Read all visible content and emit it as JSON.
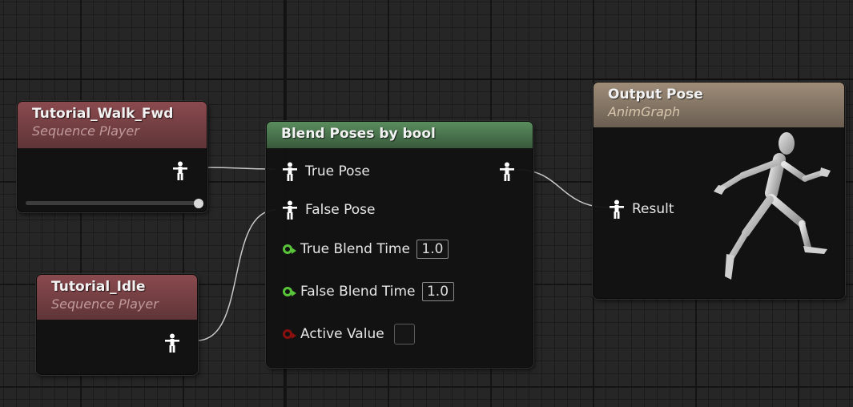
{
  "nodes": {
    "walk": {
      "title": "Tutorial_Walk_Fwd",
      "subtitle": "Sequence Player",
      "icon": "pose-pin-icon",
      "playback_position": 1.0
    },
    "idle": {
      "title": "Tutorial_Idle",
      "subtitle": "Sequence Player",
      "icon": "pose-pin-icon"
    },
    "blend": {
      "title": "Blend Poses by bool",
      "pins": {
        "true_pose": "True Pose",
        "false_pose": "False Pose",
        "true_blend_time": {
          "label": "True Blend Time",
          "value": "1.0"
        },
        "false_blend_time": {
          "label": "False Blend Time",
          "value": "1.0"
        },
        "active_value": {
          "label": "Active Value",
          "checked": false
        }
      }
    },
    "output": {
      "title": "Output Pose",
      "subtitle": "AnimGraph",
      "pin": "Result",
      "icon": "running-mannequin-icon"
    }
  },
  "colors": {
    "pose_pin": "#ffffff",
    "float_pin": "#59c43a",
    "bool_pin": "#8a1010",
    "sequence_header": "#7a4246",
    "blend_header": "#4f7f53",
    "output_header": "#8c7c6a",
    "wire": "#c8c8c8"
  }
}
